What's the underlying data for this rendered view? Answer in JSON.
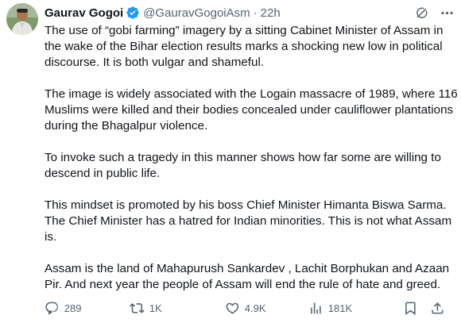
{
  "author": {
    "name": "Gaurav Gogoi",
    "handle": "@GauravGogoiAsm",
    "separator": "·",
    "time": "22h",
    "verified_color": "#1d9bf0"
  },
  "tweet": {
    "paragraphs": [
      "The use of “gobi farming” imagery by a sitting Cabinet Minister of Assam in the wake of the Bihar election results marks a shocking new low in political discourse. It is both vulgar and shameful.",
      "The image is widely associated with the Logain massacre of 1989, where 116 Muslims were killed and their bodies concealed under cauliflower plantations during the Bhagalpur violence.",
      "To invoke such a tragedy in this manner shows how far some are willing to descend in public life.",
      "This mindset is promoted by his boss Chief Minister Himanta Biswa Sarma. The Chief Minister has a hatred for Indian minorities. This is not what Assam is.",
      "Assam is the land of Mahapurush Sankardev , Lachit Borphukan and Azaan Pir. And next year the people of Assam will end the rule of hate and greed."
    ]
  },
  "metrics": {
    "replies": "289",
    "reposts": "1K",
    "likes": "4.9K",
    "views": "181K"
  },
  "icons": [
    "grok-icon",
    "more-icon",
    "reply-icon",
    "repost-icon",
    "like-icon",
    "views-icon",
    "bookmark-icon",
    "share-icon"
  ]
}
